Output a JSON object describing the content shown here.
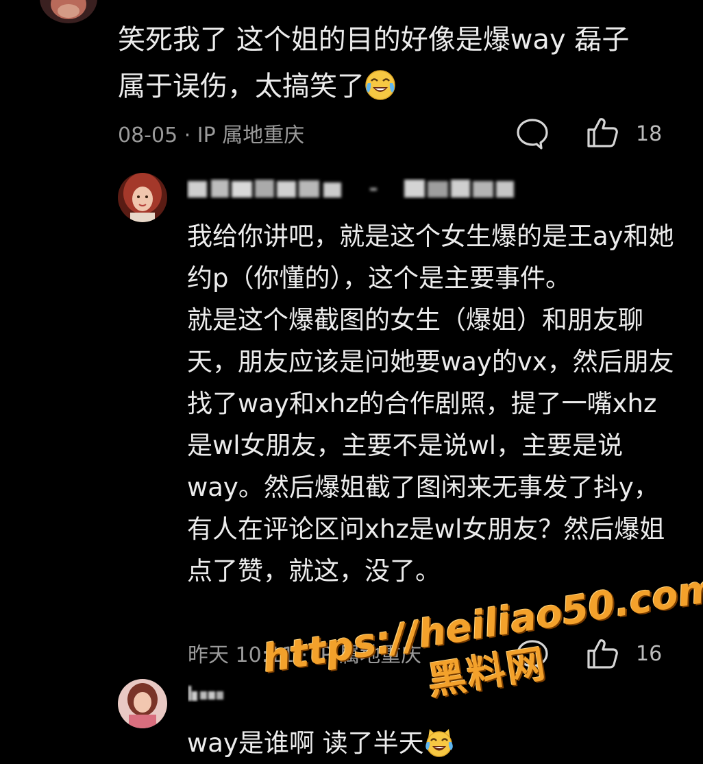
{
  "top_comment": {
    "text_line1": "笑死我了 这个姐的目的好像是爆way 磊子",
    "text_line2": "属于误伤，太搞笑了",
    "emoji": "crying-laughing-emoji",
    "meta": "08-05 · IP 属地重庆",
    "like_count": "18"
  },
  "reply_1": {
    "username": "追■■■在■■■■ · ■■■■■■",
    "paragraphs": [
      "我给你讲吧，就是这个女生爆的是王ay和她约p（你懂的），这个是主要事件。",
      "就是这个爆截图的女生（爆姐）和朋友聊天，朋友应该是问她要way的vx，然后朋友找了way和xhz的合作剧照，提了一嘴xhz是wl女朋友，主要不是说wl，主要是说way。然后爆姐截了图闲来无事发了抖y，有人在评论区问xhz是wl女朋友？然后爆姐点了赞，就这，没了。"
    ],
    "meta": "昨天 10:11 · IP 属地重庆",
    "like_count": "16"
  },
  "reply_2": {
    "username": "h■■■",
    "text": "way是谁啊 读了半天",
    "emoji": "laughing-cat-emoji"
  },
  "watermark": {
    "url": "https://heiliao50.com",
    "name": "黑料网"
  },
  "icons": {
    "comment": "comment-bubble-icon",
    "like": "thumbs-up-icon"
  },
  "colors": {
    "background": "#000000",
    "text_primary": "#ececec",
    "text_meta": "#9a9a9a",
    "watermark": "#f3a12b"
  }
}
